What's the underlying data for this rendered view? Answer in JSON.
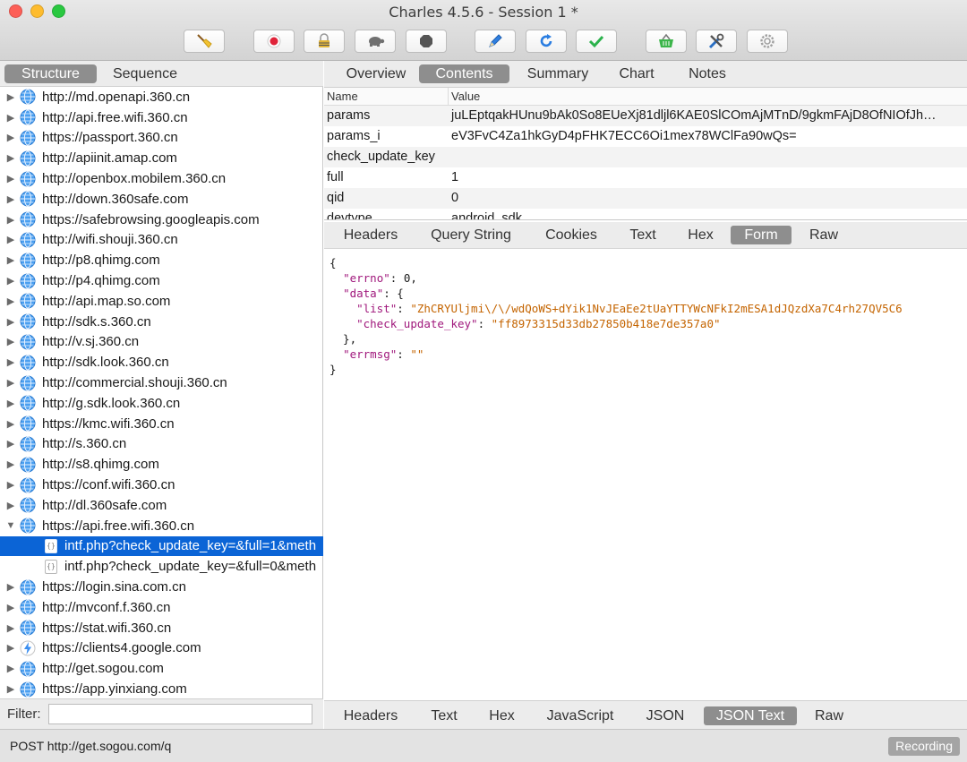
{
  "window": {
    "title": "Charles 4.5.6 - Session 1 *"
  },
  "toolbar": {
    "buttons": [
      {
        "icon": "broom-icon"
      },
      {
        "icon": "record-icon"
      },
      {
        "icon": "ssl-lock-icon"
      },
      {
        "icon": "turtle-throttle-icon"
      },
      {
        "icon": "stop-breakpoints-icon"
      },
      {
        "icon": "pen-compose-icon"
      },
      {
        "icon": "repeat-icon"
      },
      {
        "icon": "validate-check-icon"
      },
      {
        "icon": "basket-icon"
      },
      {
        "icon": "tools-icon"
      },
      {
        "icon": "settings-gear-icon"
      }
    ]
  },
  "left": {
    "tabs": [
      "Structure",
      "Sequence"
    ],
    "active_tab": "Structure",
    "hosts": [
      {
        "label": "http://md.openapi.360.cn",
        "expanded": false
      },
      {
        "label": "http://api.free.wifi.360.cn",
        "expanded": false
      },
      {
        "label": "https://passport.360.cn",
        "expanded": false
      },
      {
        "label": "http://apiinit.amap.com",
        "expanded": false
      },
      {
        "label": "http://openbox.mobilem.360.cn",
        "expanded": false
      },
      {
        "label": "http://down.360safe.com",
        "expanded": false
      },
      {
        "label": "https://safebrowsing.googleapis.com",
        "expanded": false
      },
      {
        "label": "http://wifi.shouji.360.cn",
        "expanded": false
      },
      {
        "label": "http://p8.qhimg.com",
        "expanded": false
      },
      {
        "label": "http://p4.qhimg.com",
        "expanded": false
      },
      {
        "label": "http://api.map.so.com",
        "expanded": false
      },
      {
        "label": "http://sdk.s.360.cn",
        "expanded": false
      },
      {
        "label": "http://v.sj.360.cn",
        "expanded": false
      },
      {
        "label": "http://sdk.look.360.cn",
        "expanded": false
      },
      {
        "label": "http://commercial.shouji.360.cn",
        "expanded": false
      },
      {
        "label": "http://g.sdk.look.360.cn",
        "expanded": false
      },
      {
        "label": "https://kmc.wifi.360.cn",
        "expanded": false
      },
      {
        "label": "http://s.360.cn",
        "expanded": false
      },
      {
        "label": "http://s8.qhimg.com",
        "expanded": false
      },
      {
        "label": "https://conf.wifi.360.cn",
        "expanded": false
      },
      {
        "label": "http://dl.360safe.com",
        "expanded": false
      },
      {
        "label": "https://api.free.wifi.360.cn",
        "expanded": true
      },
      {
        "label": "intf.php?check_update_key=&full=1&meth",
        "child": true,
        "selected": true
      },
      {
        "label": "intf.php?check_update_key=&full=0&meth",
        "child": true
      },
      {
        "label": "https://login.sina.com.cn",
        "expanded": false
      },
      {
        "label": "http://mvconf.f.360.cn",
        "expanded": false
      },
      {
        "label": "https://stat.wifi.360.cn",
        "expanded": false
      },
      {
        "label": "https://clients4.google.com",
        "expanded": false,
        "icon": "lightning-icon"
      },
      {
        "label": "http://get.sogou.com",
        "expanded": false
      },
      {
        "label": "https://app.yinxiang.com",
        "expanded": false
      }
    ],
    "filter_label": "Filter:",
    "filter_value": ""
  },
  "right": {
    "top_tabs": [
      "Overview",
      "Contents",
      "Summary",
      "Chart",
      "Notes"
    ],
    "active_top_tab": "Contents",
    "params_header": {
      "name": "Name",
      "value": "Value"
    },
    "params": [
      {
        "name": "params",
        "value": "juLEptqakHUnu9bAk0So8EUeXj81dljl6KAE0SlCOmAjMTnD/9gkmFAjD8OfNIOfJh…"
      },
      {
        "name": "params_i",
        "value": "eV3FvC4Za1hkGyD4pFHK7ECC6Oi1mex78WClFa90wQs="
      },
      {
        "name": "check_update_key",
        "value": ""
      },
      {
        "name": "full",
        "value": "1"
      },
      {
        "name": "qid",
        "value": "0"
      },
      {
        "name": "devtype",
        "value": "android_sdk"
      }
    ],
    "request_tabs": [
      "Headers",
      "Query String",
      "Cookies",
      "Text",
      "Hex",
      "Form",
      "Raw"
    ],
    "active_request_tab": "Form",
    "json": {
      "errno_key": "\"errno\"",
      "errno_value": "0",
      "data_key": "\"data\"",
      "list_key": "\"list\"",
      "list_value": "\"ZhCRYUljmi\\/\\/wdQoWS+dYik1NvJEaEe2tUaYTTYWcNFkI2mESA1dJQzdXa7C4rh27QV5C6",
      "cuk_key": "\"check_update_key\"",
      "cuk_value": "\"ff8973315d33db27850b418e7de357a0\"",
      "errmsg_key": "\"errmsg\"",
      "errmsg_value": "\"\""
    },
    "response_tabs": [
      "Headers",
      "Text",
      "Hex",
      "JavaScript",
      "JSON",
      "JSON Text",
      "Raw"
    ],
    "active_response_tab": "JSON Text"
  },
  "status": {
    "text": "POST http://get.sogou.com/q",
    "recording": "Recording"
  },
  "colors": {
    "selection": "#0b64d6",
    "active_tab": "#8e8e8e",
    "json_key": "#a0187c",
    "json_string": "#c46400"
  }
}
